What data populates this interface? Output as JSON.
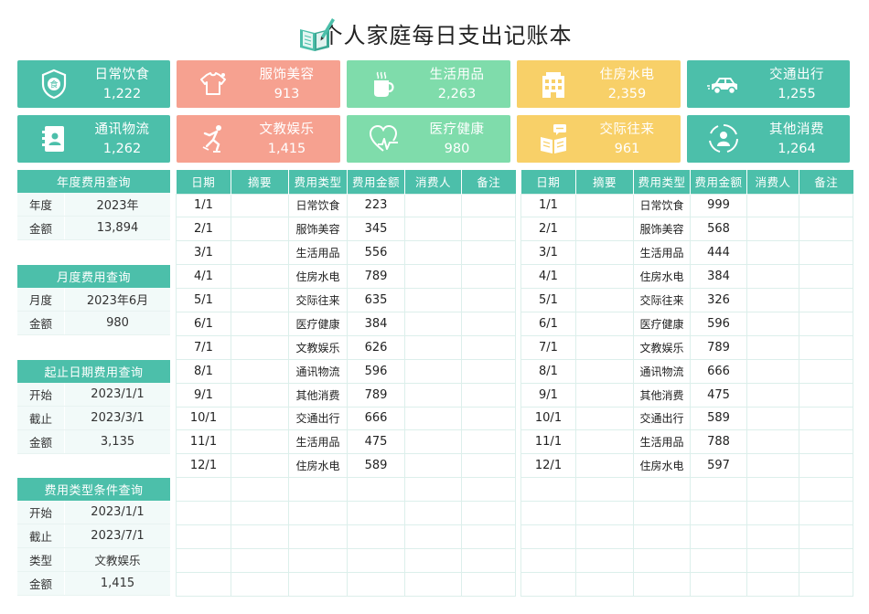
{
  "title": "个人家庭每日支出记账本",
  "colors": {
    "teal": "#4cbfaa",
    "salmon": "#f6a190",
    "green": "#7fdcab",
    "yellow": "#f8d068"
  },
  "cards": [
    {
      "label": "日常饮食",
      "value": "1,222",
      "color": "teal",
      "icon": "food-shield-icon"
    },
    {
      "label": "服饰美容",
      "value": "913",
      "color": "salmon",
      "icon": "shirt-icon"
    },
    {
      "label": "生活用品",
      "value": "2,263",
      "color": "green",
      "icon": "coffee-cup-icon"
    },
    {
      "label": "住房水电",
      "value": "2,359",
      "color": "yellow",
      "icon": "building-icon"
    },
    {
      "label": "交通出行",
      "value": "1,255",
      "color": "teal",
      "icon": "car-icon"
    },
    {
      "label": "通讯物流",
      "value": "1,262",
      "color": "teal",
      "icon": "contact-book-icon"
    },
    {
      "label": "文教娱乐",
      "value": "1,415",
      "color": "salmon",
      "icon": "skater-icon"
    },
    {
      "label": "医疗健康",
      "value": "980",
      "color": "green",
      "icon": "heartbeat-icon"
    },
    {
      "label": "交际往来",
      "value": "961",
      "color": "yellow",
      "icon": "chat-book-icon"
    },
    {
      "label": "其他消费",
      "value": "1,264",
      "color": "teal",
      "icon": "person-circle-icon"
    }
  ],
  "year_query": {
    "title": "年度费用查询",
    "year_label": "年度",
    "year_value": "2023年",
    "amount_label": "金额",
    "amount_value": "13,894"
  },
  "month_query": {
    "title": "月度费用查询",
    "month_label": "月度",
    "month_value": "2023年6月",
    "amount_label": "金额",
    "amount_value": "980"
  },
  "range_query": {
    "title": "起止日期费用查询",
    "start_label": "开始",
    "start_value": "2023/1/1",
    "end_label": "截止",
    "end_value": "2023/3/1",
    "amount_label": "金额",
    "amount_value": "3,135"
  },
  "type_query": {
    "title": "费用类型条件查询",
    "start_label": "开始",
    "start_value": "2023/1/1",
    "end_label": "截止",
    "end_value": "2023/7/1",
    "type_label": "类型",
    "type_value": "文教娱乐",
    "amount_label": "金额",
    "amount_value": "1,415"
  },
  "ledger_headers": [
    "日期",
    "摘要",
    "费用类型",
    "费用金额",
    "消费人",
    "备注"
  ],
  "ledger_left": [
    [
      "1/1",
      "",
      "日常饮食",
      "223",
      "",
      ""
    ],
    [
      "2/1",
      "",
      "服饰美容",
      "345",
      "",
      ""
    ],
    [
      "3/1",
      "",
      "生活用品",
      "556",
      "",
      ""
    ],
    [
      "4/1",
      "",
      "住房水电",
      "789",
      "",
      ""
    ],
    [
      "5/1",
      "",
      "交际往来",
      "635",
      "",
      ""
    ],
    [
      "6/1",
      "",
      "医疗健康",
      "384",
      "",
      ""
    ],
    [
      "7/1",
      "",
      "文教娱乐",
      "626",
      "",
      ""
    ],
    [
      "8/1",
      "",
      "通讯物流",
      "596",
      "",
      ""
    ],
    [
      "9/1",
      "",
      "其他消费",
      "789",
      "",
      ""
    ],
    [
      "10/1",
      "",
      "交通出行",
      "666",
      "",
      ""
    ],
    [
      "11/1",
      "",
      "生活用品",
      "475",
      "",
      ""
    ],
    [
      "12/1",
      "",
      "住房水电",
      "589",
      "",
      ""
    ],
    [
      "",
      "",
      "",
      "",
      "",
      ""
    ],
    [
      "",
      "",
      "",
      "",
      "",
      ""
    ],
    [
      "",
      "",
      "",
      "",
      "",
      ""
    ],
    [
      "",
      "",
      "",
      "",
      "",
      ""
    ],
    [
      "",
      "",
      "",
      "",
      "",
      ""
    ]
  ],
  "ledger_right": [
    [
      "1/1",
      "",
      "日常饮食",
      "999",
      "",
      ""
    ],
    [
      "2/1",
      "",
      "服饰美容",
      "568",
      "",
      ""
    ],
    [
      "3/1",
      "",
      "生活用品",
      "444",
      "",
      ""
    ],
    [
      "4/1",
      "",
      "住房水电",
      "384",
      "",
      ""
    ],
    [
      "5/1",
      "",
      "交际往来",
      "326",
      "",
      ""
    ],
    [
      "6/1",
      "",
      "医疗健康",
      "596",
      "",
      ""
    ],
    [
      "7/1",
      "",
      "文教娱乐",
      "789",
      "",
      ""
    ],
    [
      "8/1",
      "",
      "通讯物流",
      "666",
      "",
      ""
    ],
    [
      "9/1",
      "",
      "其他消费",
      "475",
      "",
      ""
    ],
    [
      "10/1",
      "",
      "交通出行",
      "589",
      "",
      ""
    ],
    [
      "11/1",
      "",
      "生活用品",
      "788",
      "",
      ""
    ],
    [
      "12/1",
      "",
      "住房水电",
      "597",
      "",
      ""
    ],
    [
      "",
      "",
      "",
      "",
      "",
      ""
    ],
    [
      "",
      "",
      "",
      "",
      "",
      ""
    ],
    [
      "",
      "",
      "",
      "",
      "",
      ""
    ],
    [
      "",
      "",
      "",
      "",
      "",
      ""
    ],
    [
      "",
      "",
      "",
      "",
      "",
      ""
    ]
  ]
}
